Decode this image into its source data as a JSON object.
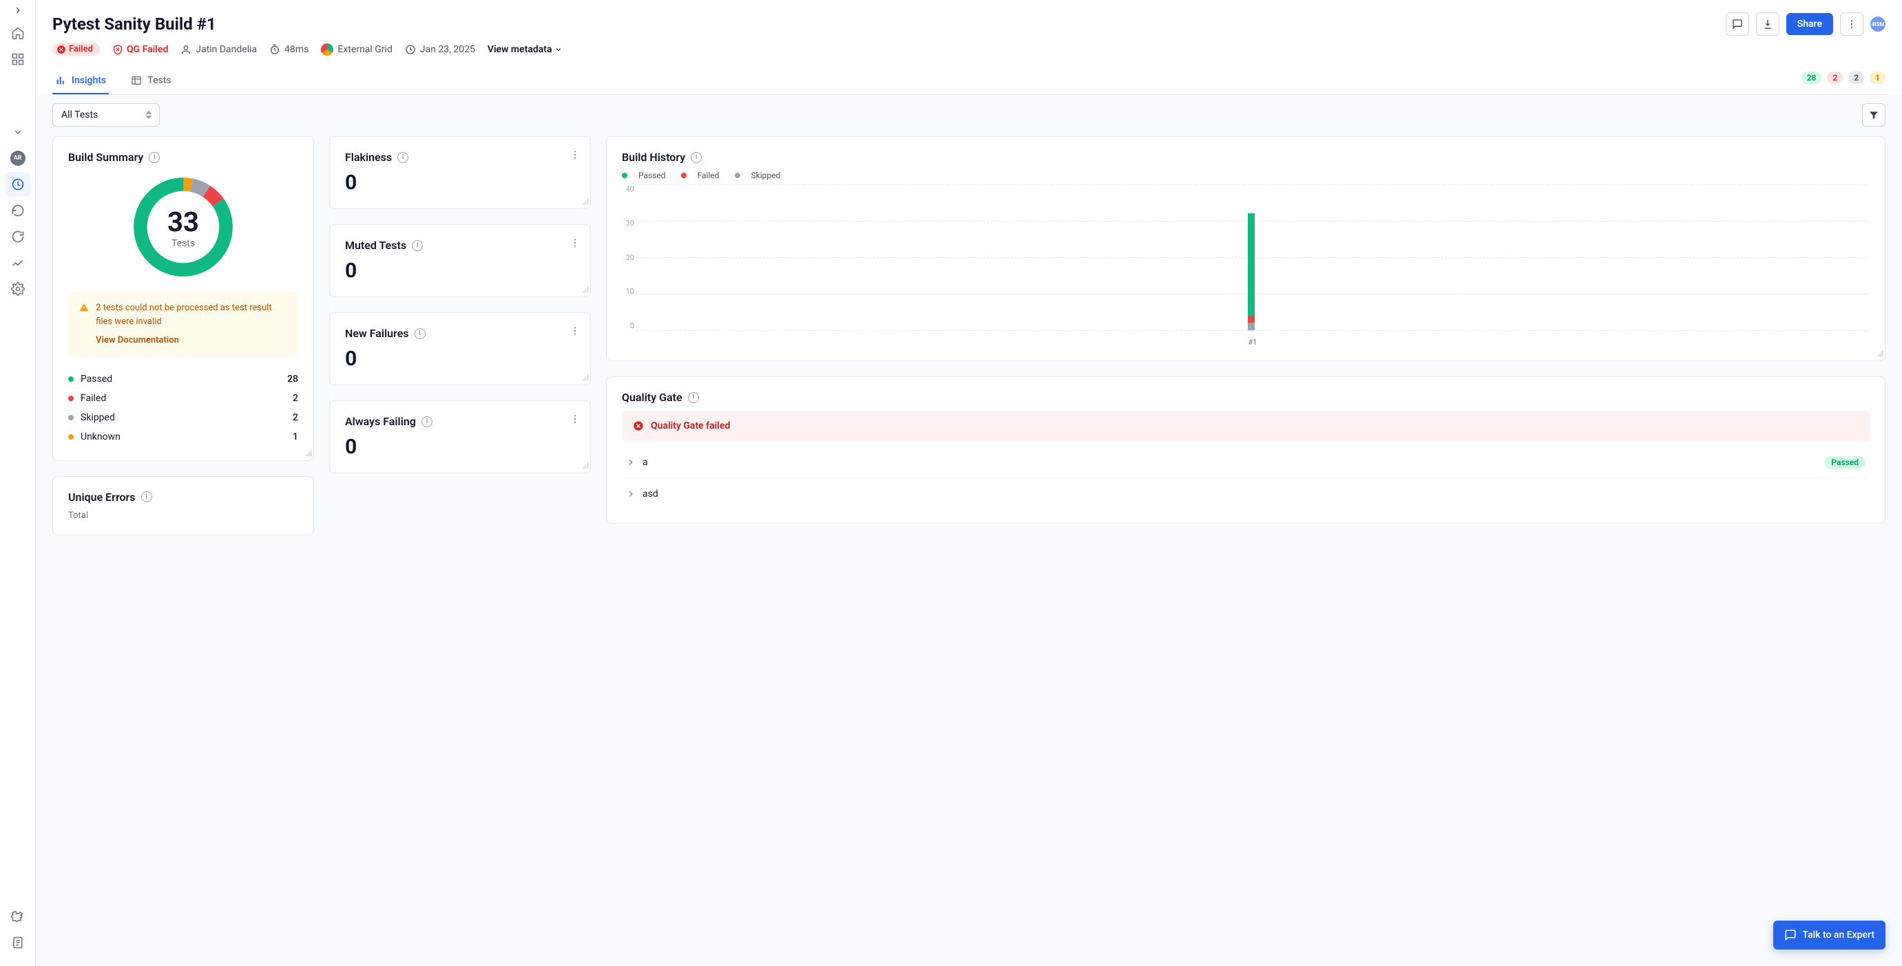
{
  "header": {
    "title": "Pytest Sanity Build #1",
    "failed_pill": "Failed",
    "qg_failed": "QG Failed",
    "user": "Jatin Dandelia",
    "duration": "48ms",
    "grid": "External Grid",
    "date": "Jan 23, 2025",
    "view_metadata": "View metadata",
    "share": "Share",
    "user_badge": "4ISM"
  },
  "tabs": {
    "insights": "Insights",
    "tests": "Tests"
  },
  "counts": {
    "passed": "28",
    "failed": "2",
    "skipped": "2",
    "unknown": "1"
  },
  "filters": {
    "all_tests": "All Tests"
  },
  "sidebar_avatar": "AR",
  "build_summary": {
    "title": "Build Summary",
    "total": "33",
    "total_label": "Tests",
    "warning": "2 tests could not be processed as test result files were invalid",
    "warning_link": "View Documentation",
    "legend": [
      {
        "label": "Passed",
        "value": "28",
        "color": "#10b981"
      },
      {
        "label": "Failed",
        "value": "2",
        "color": "#ef4444"
      },
      {
        "label": "Skipped",
        "value": "2",
        "color": "#9ca3af"
      },
      {
        "label": "Unknown",
        "value": "1",
        "color": "#f59e0b"
      }
    ]
  },
  "small_cards": {
    "flakiness": {
      "title": "Flakiness",
      "value": "0"
    },
    "muted": {
      "title": "Muted Tests",
      "value": "0"
    },
    "new_failures": {
      "title": "New Failures",
      "value": "0"
    },
    "always_failing": {
      "title": "Always Failing",
      "value": "0"
    }
  },
  "build_history": {
    "title": "Build History",
    "legend": {
      "passed": "Passed",
      "failed": "Failed",
      "skipped": "Skipped"
    }
  },
  "quality_gate": {
    "title": "Quality Gate",
    "banner": "Quality Gate failed",
    "rows": [
      {
        "name": "a",
        "status": "Passed"
      },
      {
        "name": "asd",
        "status": ""
      }
    ]
  },
  "unique_errors": {
    "title": "Unique Errors",
    "total_label": "Total"
  },
  "chat": "Talk to an Expert",
  "chart_data": {
    "type": "bar",
    "title": "Build History",
    "x": [
      "#1"
    ],
    "ylim": [
      0,
      40
    ],
    "yticks": [
      0,
      10,
      20,
      30,
      40
    ],
    "series": [
      {
        "name": "Passed",
        "values": [
          28
        ],
        "color": "#10b981"
      },
      {
        "name": "Failed",
        "values": [
          2
        ],
        "color": "#ef4444"
      },
      {
        "name": "Skipped",
        "values": [
          2
        ],
        "color": "#9ca3af"
      }
    ]
  }
}
